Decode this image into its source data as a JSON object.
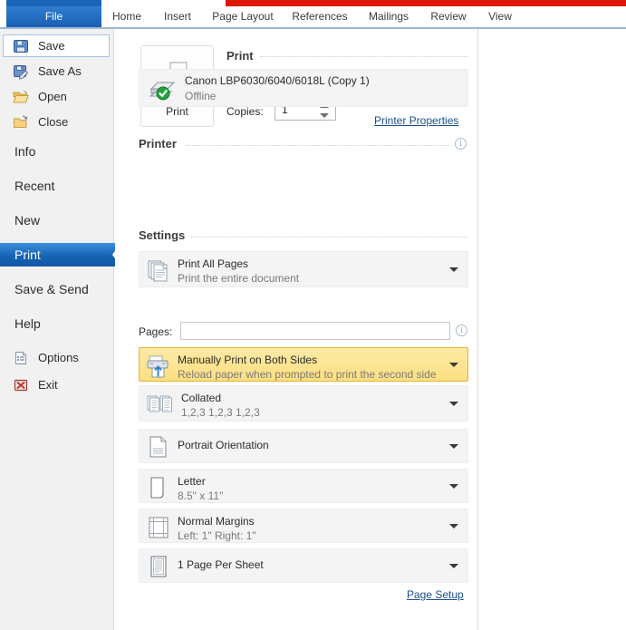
{
  "window": {
    "accent_red": "#dd1707",
    "accent_blue": "#1a64b8",
    "highlight_yellow": "#fcdf80"
  },
  "ribbon": {
    "tabs": [
      {
        "label": "File",
        "active": true
      },
      {
        "label": "Home",
        "active": false
      },
      {
        "label": "Insert",
        "active": false
      },
      {
        "label": "Page Layout",
        "active": false
      },
      {
        "label": "References",
        "active": false
      },
      {
        "label": "Mailings",
        "active": false
      },
      {
        "label": "Review",
        "active": false
      },
      {
        "label": "View",
        "active": false
      }
    ]
  },
  "sidebar": {
    "items": [
      {
        "label": "Save",
        "icon": "floppy-disk-icon"
      },
      {
        "label": "Save As",
        "icon": "floppy-disk-pencil-icon"
      },
      {
        "label": "Open",
        "icon": "open-folder-icon"
      },
      {
        "label": "Close",
        "icon": "close-folder-icon"
      },
      {
        "label": "Info",
        "icon": null
      },
      {
        "label": "Recent",
        "icon": null
      },
      {
        "label": "New",
        "icon": null
      },
      {
        "label": "Print",
        "icon": null
      },
      {
        "label": "Save & Send",
        "icon": null
      },
      {
        "label": "Help",
        "icon": null
      },
      {
        "label": "Options",
        "icon": "options-document-icon"
      },
      {
        "label": "Exit",
        "icon": "exit-x-icon"
      }
    ],
    "selected": "Print"
  },
  "print": {
    "button_label": "Print",
    "heading": "Print",
    "copies_label": "Copies:",
    "copies_value": "1"
  },
  "printer": {
    "heading": "Printer",
    "name": "Canon LBP6030/6040/6018L (Copy 1)",
    "status": "Offline",
    "properties_link": "Printer Properties"
  },
  "settings": {
    "heading": "Settings",
    "pages_label": "Pages:",
    "pages_value": "",
    "pages_placeholder": "",
    "page_setup_link": "Page Setup",
    "rows": [
      {
        "title": "Print All Pages",
        "subtitle": "Print the entire document",
        "icon": "pages-stack-icon",
        "highlighted": false
      },
      {
        "title": "Manually Print on Both Sides",
        "subtitle": "Reload paper when prompted to print the second side",
        "icon": "duplex-printer-icon",
        "highlighted": true
      },
      {
        "title": "Collated",
        "subtitle": "1,2,3   1,2,3   1,2,3",
        "icon": "collate-icon",
        "highlighted": false
      },
      {
        "title": "Portrait Orientation",
        "subtitle": "",
        "icon": "portrait-page-icon",
        "highlighted": false
      },
      {
        "title": "Letter",
        "subtitle": "8.5\" x 11\"",
        "icon": "paper-size-icon",
        "highlighted": false
      },
      {
        "title": "Normal Margins",
        "subtitle": "Left:  1\"    Right:  1\"",
        "icon": "margins-icon",
        "highlighted": false
      },
      {
        "title": "1 Page Per Sheet",
        "subtitle": "",
        "icon": "pages-per-sheet-icon",
        "highlighted": false
      }
    ]
  }
}
